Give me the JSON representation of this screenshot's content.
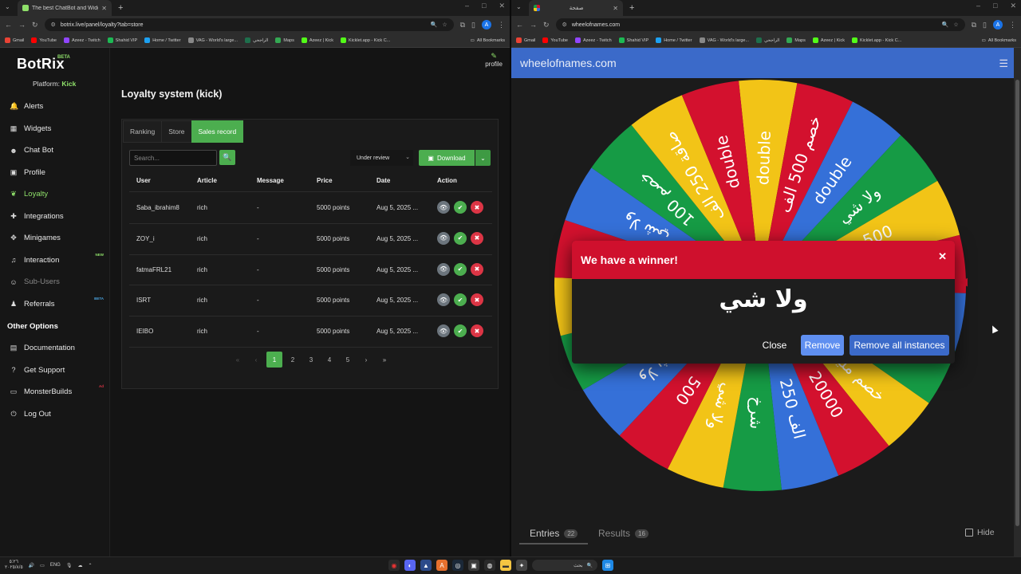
{
  "left_browser": {
    "tab_title": "The best ChatBot and Widgets",
    "url": "botrix.live/panel/loyalty?tab=store",
    "bookmarks": [
      "Gmail",
      "YouTube",
      "Azeez - Twitch",
      "Shahid VIP",
      "Home / Twitter",
      "VAG - World's large...",
      "الراجحي",
      "Maps",
      "Azeez | Kick",
      "Kicklet.app - Kick C..."
    ],
    "all_bookmarks": "All Bookmarks",
    "avatar_letter": "A"
  },
  "right_browser": {
    "tab_title": "صفحة",
    "url": "wheelofnames.com",
    "bookmarks": [
      "Gmail",
      "YouTube",
      "Azeez - Twitch",
      "Shahid VIP",
      "Home / Twitter",
      "VAG - World's large...",
      "الراجحي",
      "Maps",
      "Azeez | Kick",
      "Kicklet.app - Kick C..."
    ],
    "all_bookmarks": "All Bookmarks",
    "avatar_letter": "A"
  },
  "botrix": {
    "logo": "BotRix",
    "logo_badge": "BETA",
    "platform_label": "Platform:",
    "platform_value": "Kick",
    "profile_label": "profile",
    "nav": [
      {
        "label": "Alerts",
        "icon": "bell-icon",
        "glyph": "🔔",
        "badge": "",
        "badge_color": ""
      },
      {
        "label": "Widgets",
        "icon": "grid-icon",
        "glyph": "▦",
        "badge": "",
        "badge_color": ""
      },
      {
        "label": "Chat Bot",
        "icon": "robot-icon",
        "glyph": "☻",
        "badge": "",
        "badge_color": ""
      },
      {
        "label": "Profile",
        "icon": "id-card-icon",
        "glyph": "▣",
        "badge": "",
        "badge_color": ""
      },
      {
        "label": "Loyalty",
        "icon": "leaf-icon",
        "glyph": "❦",
        "badge": "",
        "badge_color": ""
      },
      {
        "label": "Integrations",
        "icon": "puzzle-icon",
        "glyph": "✚",
        "badge": "",
        "badge_color": ""
      },
      {
        "label": "Minigames",
        "icon": "gamepad-icon",
        "glyph": "✥",
        "badge": "",
        "badge_color": ""
      },
      {
        "label": "Interaction",
        "icon": "music-icon",
        "glyph": "♫",
        "badge": "NEW",
        "badge_color": "#8fe06a"
      },
      {
        "label": "Sub-Users",
        "icon": "users-icon",
        "glyph": "☺",
        "badge": "",
        "badge_color": ""
      },
      {
        "label": "Referrals",
        "icon": "people-icon",
        "glyph": "♟",
        "badge": "BETA",
        "badge_color": "#4aa3df"
      }
    ],
    "other_options": "Other Options",
    "nav2": [
      {
        "label": "Documentation",
        "icon": "book-icon",
        "glyph": "▤",
        "badge": "",
        "badge_color": ""
      },
      {
        "label": "Get Support",
        "icon": "help-icon",
        "glyph": "?",
        "badge": "",
        "badge_color": ""
      },
      {
        "label": "MonsterBuilds",
        "icon": "monitor-icon",
        "glyph": "▭",
        "badge": "Ad",
        "badge_color": "#dc3545"
      },
      {
        "label": "Log Out",
        "icon": "logout-icon",
        "glyph": "⏻",
        "badge": "",
        "badge_color": ""
      }
    ],
    "page_title": "Loyalty system (kick)",
    "tabs": [
      "Ranking",
      "Store",
      "Sales record"
    ],
    "search_placeholder": "Search...",
    "filter_value": "Under review",
    "download_label": "Download",
    "columns": [
      "User",
      "Article",
      "Message",
      "Price",
      "Date",
      "Action"
    ],
    "rows": [
      {
        "user": "Saba_ibrahim8",
        "article": "rich",
        "message": "-",
        "price": "5000 points",
        "date": "Aug 5, 2025 ..."
      },
      {
        "user": "ZOY_i",
        "article": "rich",
        "message": "-",
        "price": "5000 points",
        "date": "Aug 5, 2025 ..."
      },
      {
        "user": "fatmaFRL21",
        "article": "rich",
        "message": "-",
        "price": "5000 points",
        "date": "Aug 5, 2025 ..."
      },
      {
        "user": "ISRT",
        "article": "rich",
        "message": "-",
        "price": "5000 points",
        "date": "Aug 5, 2025 ..."
      },
      {
        "user": "IEIBO",
        "article": "rich",
        "message": "-",
        "price": "5000 points",
        "date": "Aug 5, 2025 ..."
      }
    ],
    "pages": [
      "1",
      "2",
      "3",
      "4",
      "5"
    ],
    "current_page": "1"
  },
  "wheel": {
    "site_title": "wheelofnames.com",
    "segments": [
      {
        "label": "double",
        "color": "#f2c417"
      },
      {
        "label": "خصم 500 الف",
        "color": "#d3112e"
      },
      {
        "label": "double",
        "color": "#3570d8"
      },
      {
        "label": "ولا شي",
        "color": "#169b45"
      },
      {
        "label": "500",
        "color": "#f2c417"
      },
      {
        "label": "صاقة 500",
        "color": "#d3112e"
      },
      {
        "label": "ناخذ نص الي",
        "color": "#3570d8"
      },
      {
        "label": "ولا شي",
        "color": "#169b45"
      },
      {
        "label": "خصم مليون",
        "color": "#f2c417"
      },
      {
        "label": "20000",
        "color": "#d3112e"
      },
      {
        "label": "الف 250",
        "color": "#3570d8"
      },
      {
        "label": "شرخ",
        "color": "#169b45"
      },
      {
        "label": "ولا شي",
        "color": "#f2c417"
      },
      {
        "label": "500",
        "color": "#d3112e"
      },
      {
        "label": "ولا شي",
        "color": "#3570d8"
      },
      {
        "label": "خصم 500",
        "color": "#169b45"
      },
      {
        "label": "الف 100",
        "color": "#f2c417"
      },
      {
        "label": "double",
        "color": "#d3112e"
      },
      {
        "label": "ولا شي",
        "color": "#3570d8"
      },
      {
        "label": "خصم 100",
        "color": "#169b45"
      },
      {
        "label": "صاقة 250 الف",
        "color": "#f2c417"
      },
      {
        "label": "double",
        "color": "#d3112e"
      }
    ],
    "dialog_title": "We have a winner!",
    "winner": "ولا شي",
    "close_label": "Close",
    "remove_label": "Remove",
    "remove_all_label": "Remove all instances",
    "entries_label": "Entries",
    "entries_count": "22",
    "results_label": "Results",
    "results_count": "16",
    "hide_label": "Hide"
  },
  "taskbar": {
    "time": "٥:٢٦",
    "date": "٢٠٢٥/٨/٥",
    "lang": "ENG",
    "search_text": "بحث"
  }
}
